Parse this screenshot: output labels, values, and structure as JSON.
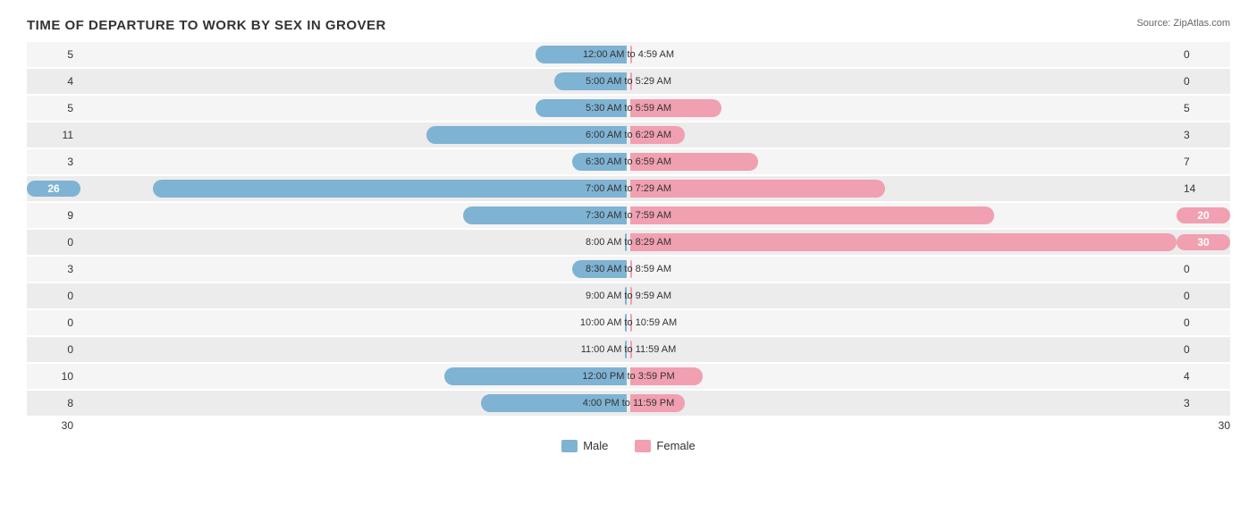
{
  "title": "TIME OF DEPARTURE TO WORK BY SEX IN GROVER",
  "source": "Source: ZipAtlas.com",
  "max_value": 30,
  "axis": {
    "left": "30",
    "right": "30"
  },
  "legend": {
    "male_label": "Male",
    "female_label": "Female"
  },
  "rows": [
    {
      "label": "12:00 AM to 4:59 AM",
      "male": 5,
      "female": 0
    },
    {
      "label": "5:00 AM to 5:29 AM",
      "male": 4,
      "female": 0
    },
    {
      "label": "5:30 AM to 5:59 AM",
      "male": 5,
      "female": 5
    },
    {
      "label": "6:00 AM to 6:29 AM",
      "male": 11,
      "female": 3
    },
    {
      "label": "6:30 AM to 6:59 AM",
      "male": 3,
      "female": 7
    },
    {
      "label": "7:00 AM to 7:29 AM",
      "male": 26,
      "female": 14
    },
    {
      "label": "7:30 AM to 7:59 AM",
      "male": 9,
      "female": 20
    },
    {
      "label": "8:00 AM to 8:29 AM",
      "male": 0,
      "female": 30
    },
    {
      "label": "8:30 AM to 8:59 AM",
      "male": 3,
      "female": 0
    },
    {
      "label": "9:00 AM to 9:59 AM",
      "male": 0,
      "female": 0
    },
    {
      "label": "10:00 AM to 10:59 AM",
      "male": 0,
      "female": 0
    },
    {
      "label": "11:00 AM to 11:59 AM",
      "male": 0,
      "female": 0
    },
    {
      "label": "12:00 PM to 3:59 PM",
      "male": 10,
      "female": 4
    },
    {
      "label": "4:00 PM to 11:59 PM",
      "male": 8,
      "female": 3
    }
  ]
}
